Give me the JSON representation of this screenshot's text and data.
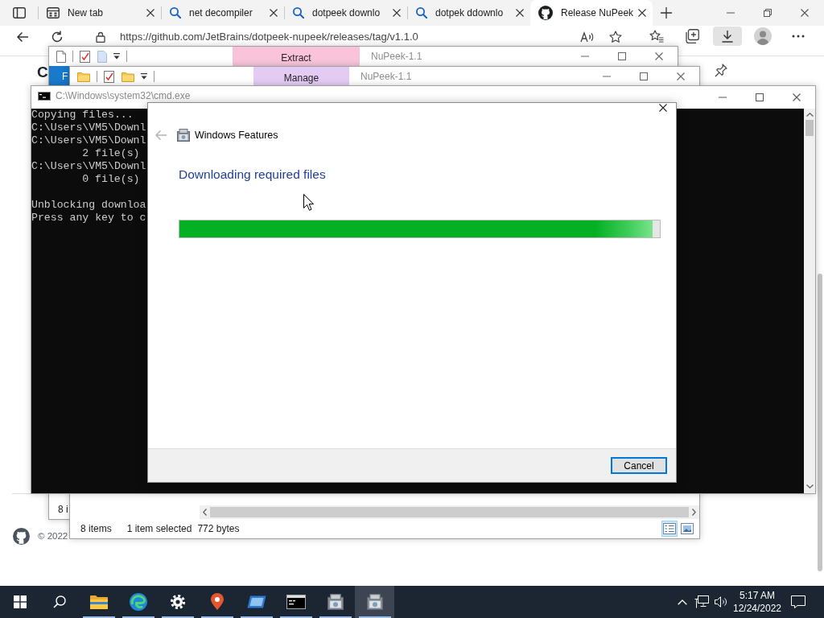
{
  "browser": {
    "tabs": [
      {
        "label": "New tab",
        "kind": "grid",
        "selected": false
      },
      {
        "label": "net decompiler",
        "kind": "search",
        "selected": false
      },
      {
        "label": "dotpeek downlo",
        "kind": "search",
        "selected": false
      },
      {
        "label": "dotpek ddownlo",
        "kind": "search",
        "selected": false
      },
      {
        "label": "Release NuPeek",
        "kind": "logo",
        "selected": true
      }
    ],
    "url": "https://github.com/JetBrains/dotpeek-nupeek/releases/tag/v1.1.0",
    "toolbar": [
      {
        "kind": "favorites",
        "selected": false
      },
      {
        "kind": "collections",
        "selected": false
      },
      {
        "kind": "downloads",
        "selected": true
      },
      {
        "kind": "profile",
        "selected": false
      },
      {
        "kind": "more",
        "selected": false
      }
    ],
    "page": {
      "heading": "C",
      "footer": "© 2022"
    }
  },
  "explorers": [
    {
      "quick_access": [
        {
          "kind": "page"
        },
        {
          "kind": "properties"
        },
        {
          "kind": "pale-page"
        },
        {
          "kind": "customize"
        }
      ],
      "context_tab": "Extract",
      "color": "#f9c4da",
      "title": "NuPeek-1.1",
      "ribbon_tab": "F",
      "status": [
        "8 i"
      ]
    },
    {
      "quick_access": [
        {
          "kind": "folder"
        },
        {
          "kind": "properties"
        },
        {
          "kind": "folder"
        },
        {
          "kind": "customize"
        }
      ],
      "context_tab": "Manage",
      "color": "#e4cbf4",
      "title": "NuPeek-1.1",
      "status": [
        "8 items",
        "1 item selected",
        "772 bytes"
      ],
      "views": [
        {
          "kind": "details",
          "selected": true
        },
        {
          "kind": "large-icons",
          "selected": false
        }
      ]
    }
  ],
  "console": {
    "title": "C:\\Windows\\system32\\cmd.exe",
    "blocks": [
      [
        "Copying files...",
        "C:\\Users\\VM5\\Downl",
        "C:\\Users\\VM5\\Downl",
        "        2 file(s)",
        "C:\\Users\\VM5\\Downl",
        "        0 file(s)"
      ],
      [
        "Unblocking downloa",
        "Press any key to c"
      ]
    ]
  },
  "dialog": {
    "title": "Windows Features",
    "back": {
      "disabled": true
    },
    "heading": "Downloading required files",
    "progress": {
      "level": 0.985
    },
    "buttons": [
      {
        "label": "Cancel",
        "focused": true
      }
    ]
  },
  "taskbar": {
    "apps": [
      {
        "kind": "folder",
        "running": true,
        "selected": false
      },
      {
        "kind": "browser",
        "running": true,
        "selected": false
      },
      {
        "kind": "gear",
        "running": true,
        "selected": false
      },
      {
        "kind": "map-pin",
        "running": true,
        "selected": false
      },
      {
        "kind": "window",
        "running": true,
        "selected": false
      },
      {
        "kind": "terminal",
        "running": true,
        "selected": false
      },
      {
        "kind": "installer",
        "running": true,
        "selected": false
      },
      {
        "kind": "installer",
        "running": true,
        "selected": true
      }
    ],
    "tray": {
      "time": "5:17 AM",
      "date": "12/24/2022"
    }
  }
}
